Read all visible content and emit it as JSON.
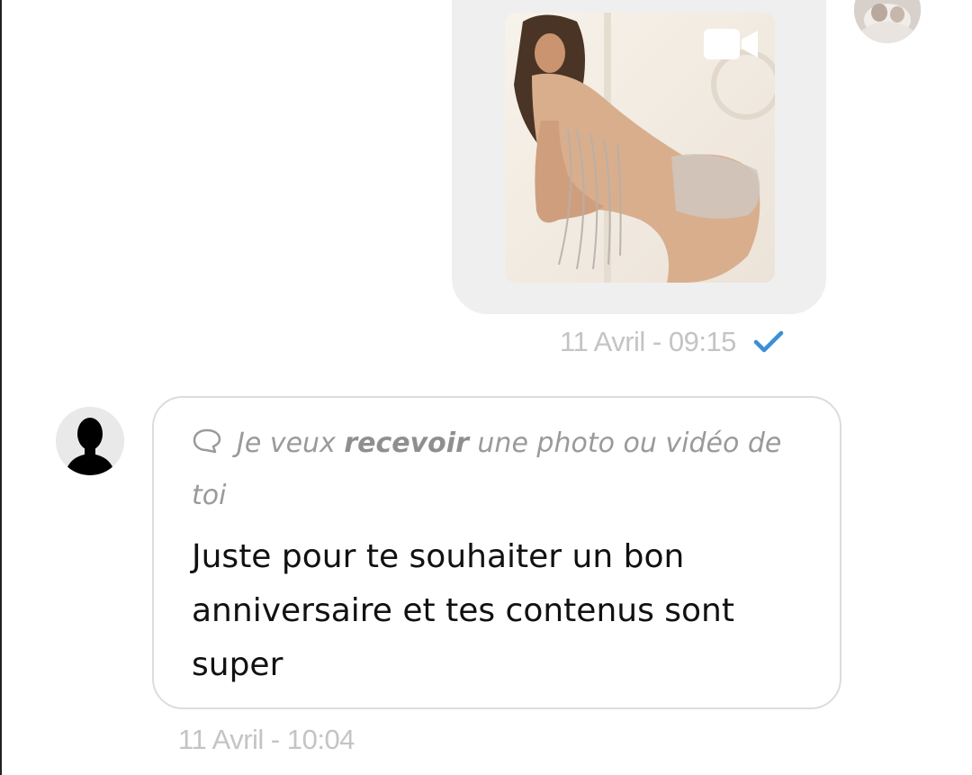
{
  "outgoing_message": {
    "media_type": "video",
    "media_icon": "video-camera-icon",
    "timestamp": "11 Avril - 09:15",
    "status_icon": "checkmark-icon",
    "status_color": "#3a8fd6"
  },
  "incoming_message": {
    "request": {
      "icon": "chat-bubble-icon",
      "prefix": "Je veux ",
      "emphasis": "recevoir",
      "suffix": " une photo ou vidéo de toi"
    },
    "text": "Juste pour te souhaiter un bon anniversaire et tes contenus sont super",
    "timestamp": "11 Avril - 10:04"
  },
  "colors": {
    "bubble_fill": "#efefef",
    "bubble_border": "#dcdcdc",
    "meta_text": "#c4c4c4"
  }
}
